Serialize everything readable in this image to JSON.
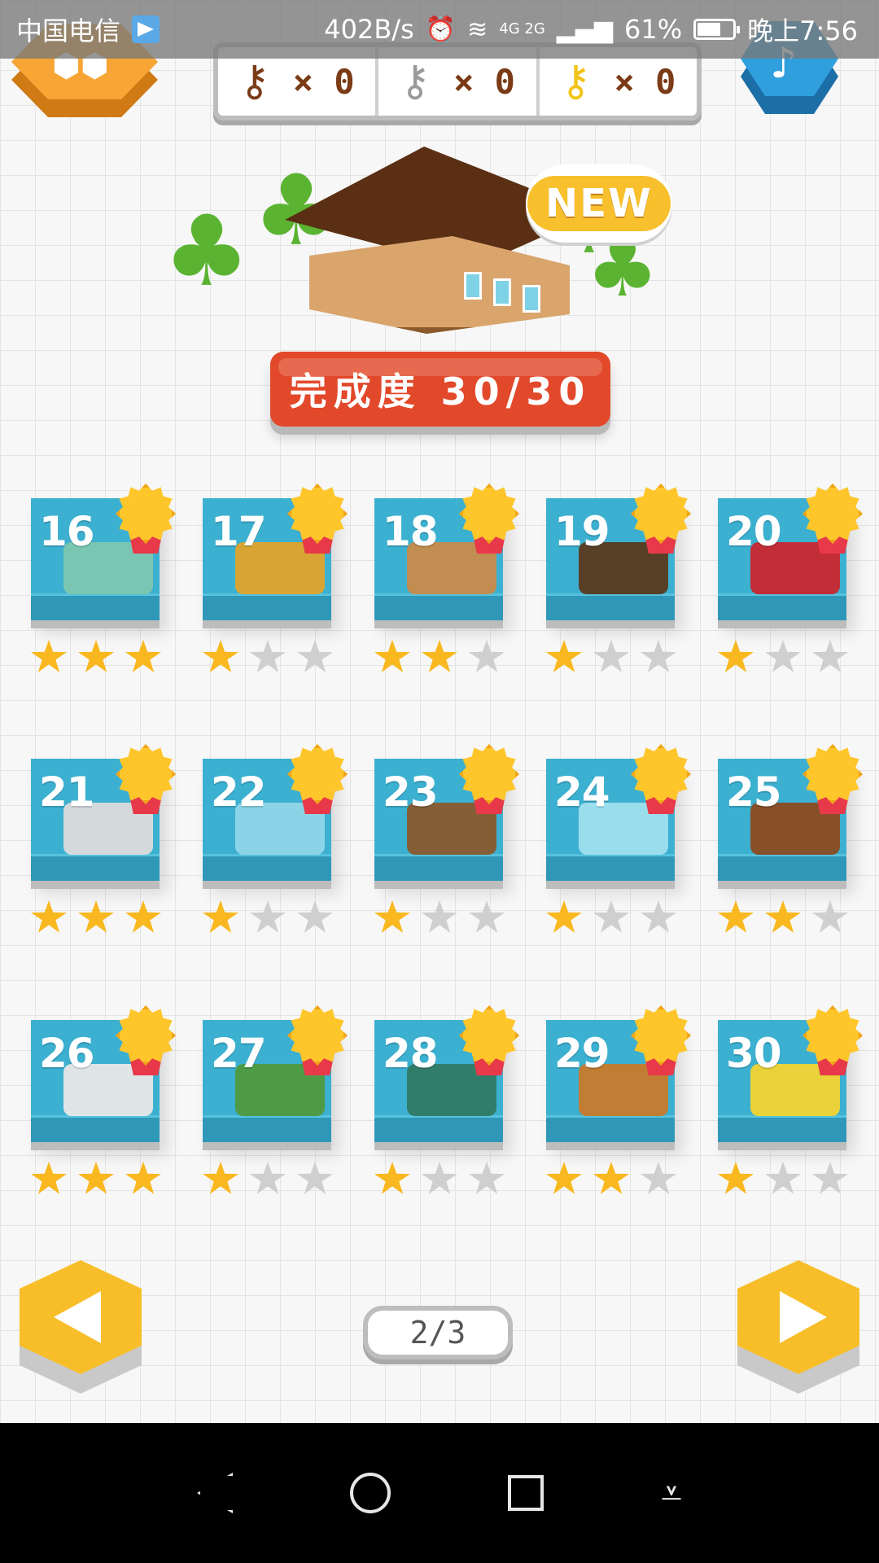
{
  "status_bar": {
    "carrier": "中国电信",
    "speed": "402B/s",
    "network": "4G 2G",
    "battery": "61%",
    "battery_level": 0.61,
    "time": "晚上7:56"
  },
  "keys": [
    {
      "name": "bronze-key",
      "count": "× 0",
      "color": "#7a3b16"
    },
    {
      "name": "silver-key",
      "count": "× 0",
      "color": "#9a9a9a"
    },
    {
      "name": "gold-key",
      "count": "× 0",
      "color": "#f2c417"
    }
  ],
  "header": {
    "new_badge": "NEW",
    "completion": "完成度 30/30"
  },
  "levels": [
    {
      "num": "16",
      "stars": 3,
      "art": "#7ec7b0"
    },
    {
      "num": "17",
      "stars": 1,
      "art": "#e0a32a"
    },
    {
      "num": "18",
      "stars": 2,
      "art": "#c98b4a"
    },
    {
      "num": "19",
      "stars": 1,
      "art": "#5a3a1c"
    },
    {
      "num": "20",
      "stars": 1,
      "art": "#c9262e"
    },
    {
      "num": "21",
      "stars": 3,
      "art": "#dcdcdc"
    },
    {
      "num": "22",
      "stars": 1,
      "art": "#8fd6e8"
    },
    {
      "num": "23",
      "stars": 1,
      "art": "#8a5a2c"
    },
    {
      "num": "24",
      "stars": 1,
      "art": "#9fe0ee"
    },
    {
      "num": "25",
      "stars": 2,
      "art": "#8b4b20"
    },
    {
      "num": "26",
      "stars": 3,
      "art": "#e8e8e8"
    },
    {
      "num": "27",
      "stars": 1,
      "art": "#4f9a3e"
    },
    {
      "num": "28",
      "stars": 1,
      "art": "#2f7a64"
    },
    {
      "num": "29",
      "stars": 2,
      "art": "#c87a2a"
    },
    {
      "num": "30",
      "stars": 1,
      "art": "#f2d431"
    }
  ],
  "pagination": {
    "page": "2/3"
  },
  "colors": {
    "card": "#3cb0d0",
    "banner": "#e2482a",
    "star_on": "#f9b81f",
    "star_off": "#cfcfcf",
    "arrow": "#f8be2a"
  },
  "icons": {
    "menu": "hex-menu-icon",
    "music": "music-note-icon",
    "prev": "arrow-left-icon",
    "next": "arrow-right-icon"
  }
}
